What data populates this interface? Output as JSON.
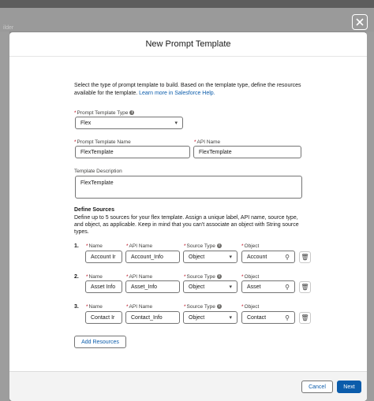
{
  "background": {
    "builder_text": "ilder"
  },
  "modal": {
    "title": "New Prompt Template",
    "intro": "Select the type of prompt template to build. Based on the template type, define the resources available for the template.",
    "learn_more_link": "Learn more in Salesforce Help.",
    "template_type": {
      "label": "Prompt Template Type",
      "value": "Flex"
    },
    "template_name": {
      "label": "Prompt Template Name",
      "value": "FlexTemplate"
    },
    "api_name": {
      "label": "API Name",
      "value": "FlexTemplate"
    },
    "description": {
      "label": "Template Description",
      "value": "FlexTemplate"
    },
    "sources": {
      "title": "Define Sources",
      "description": "Define up to 5 sources for your flex template. Assign a unique label, API name, source type, and object, as applicable. Keep in mind that you can't associate an object with String source types.",
      "labels": {
        "name": "Name",
        "api_name": "API Name",
        "source_type": "Source Type",
        "object": "Object"
      },
      "rows": [
        {
          "number": "1.",
          "name": "Account Ir",
          "api_name": "Account_Info",
          "source_type": "Object",
          "object": "Account"
        },
        {
          "number": "2.",
          "name": "Asset Info",
          "api_name": "Asset_Info",
          "source_type": "Object",
          "object": "Asset"
        },
        {
          "number": "3.",
          "name": "Contact Ir",
          "api_name": "Contact_Info",
          "source_type": "Object",
          "object": "Contact"
        }
      ],
      "add_button": "Add Resources"
    },
    "footer": {
      "cancel": "Cancel",
      "next": "Next"
    }
  },
  "colors": {
    "brand": "#0b5cab",
    "required": "#ba0517",
    "backdrop": "#8a8a8a"
  },
  "icons": [
    "close-icon",
    "info-icon",
    "chevron-down-icon",
    "search-icon",
    "trash-icon"
  ]
}
